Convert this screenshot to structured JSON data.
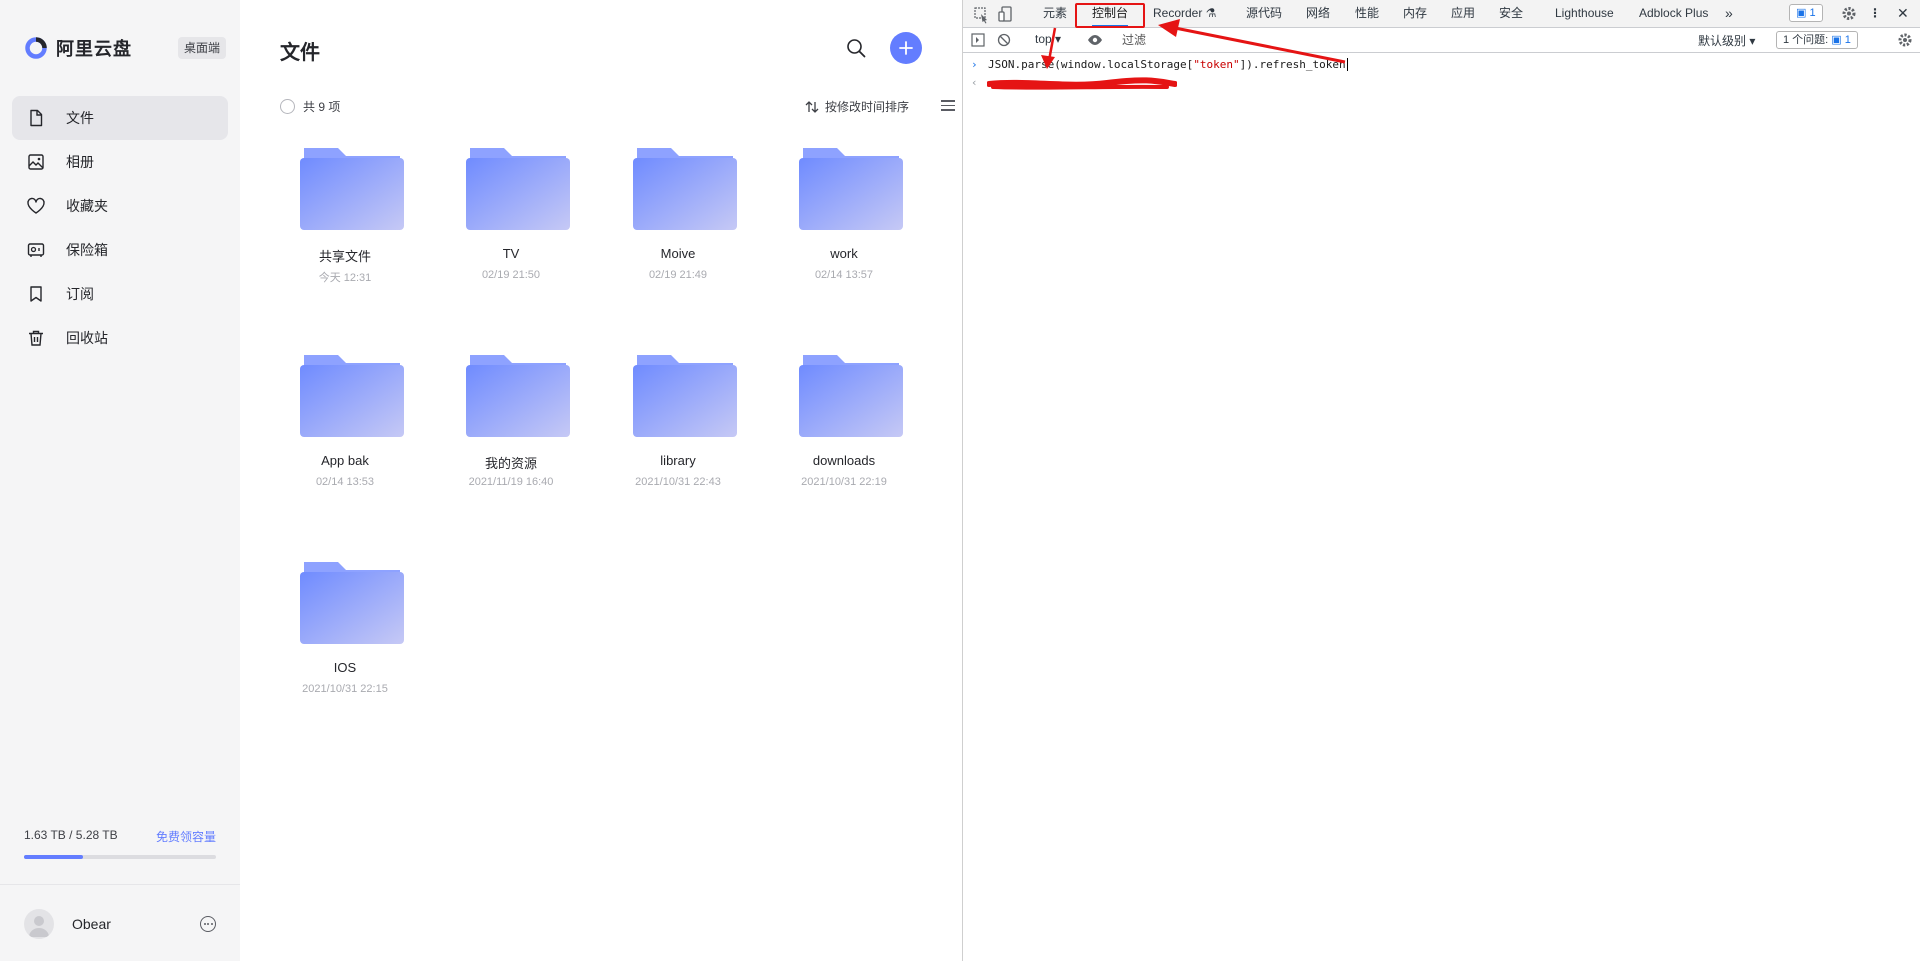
{
  "brand": {
    "name": "阿里云盘",
    "desktop_label": "桌面端"
  },
  "sidebar": {
    "items": [
      {
        "label": "文件",
        "icon": "file-icon",
        "active": true
      },
      {
        "label": "相册",
        "icon": "photo-icon",
        "active": false
      },
      {
        "label": "收藏夹",
        "icon": "heart-icon",
        "active": false
      },
      {
        "label": "保险箱",
        "icon": "safe-icon",
        "active": false
      },
      {
        "label": "订阅",
        "icon": "bookmark-icon",
        "active": false
      },
      {
        "label": "回收站",
        "icon": "trash-icon",
        "active": false
      }
    ],
    "storage": {
      "used_text": "1.63 TB / 5.28 TB",
      "used_fraction": 0.309,
      "free_link": "免费领容量"
    },
    "user": {
      "name": "Obear"
    }
  },
  "main": {
    "title": "文件",
    "count_text": "共 9 项",
    "sort_label": "按修改时间排序",
    "files": [
      {
        "name": "共享文件",
        "date": "今天 12:31"
      },
      {
        "name": "TV",
        "date": "02/19 21:50"
      },
      {
        "name": "Moive",
        "date": "02/19 21:49"
      },
      {
        "name": "work",
        "date": "02/14 13:57"
      },
      {
        "name": "App bak",
        "date": "02/14 13:53"
      },
      {
        "name": "我的资源",
        "date": "2021/11/19 16:40"
      },
      {
        "name": "library",
        "date": "2021/10/31 22:43"
      },
      {
        "name": "downloads",
        "date": "2021/10/31 22:19"
      },
      {
        "name": "IOS",
        "date": "2021/10/31 22:15"
      }
    ]
  },
  "devtools": {
    "tabs": [
      "元素",
      "控制台",
      "Recorder",
      "源代码",
      "网络",
      "性能",
      "内存",
      "应用",
      "安全",
      "Lighthouse",
      "Adblock Plus"
    ],
    "active_tab": "控制台",
    "issues_badge": "1",
    "context": "top",
    "filter_placeholder": "过滤",
    "level": "默认级别",
    "issues_text": "1 个问题:",
    "issues_count": "1",
    "console": {
      "input_prefix": "JSON.parse(window.localStorage[",
      "input_string": "\"token\"",
      "input_suffix": "]).refresh_token"
    }
  },
  "colors": {
    "accent": "#637dff",
    "annotation": "#e51414",
    "devtools_blue": "#1a73e8"
  }
}
